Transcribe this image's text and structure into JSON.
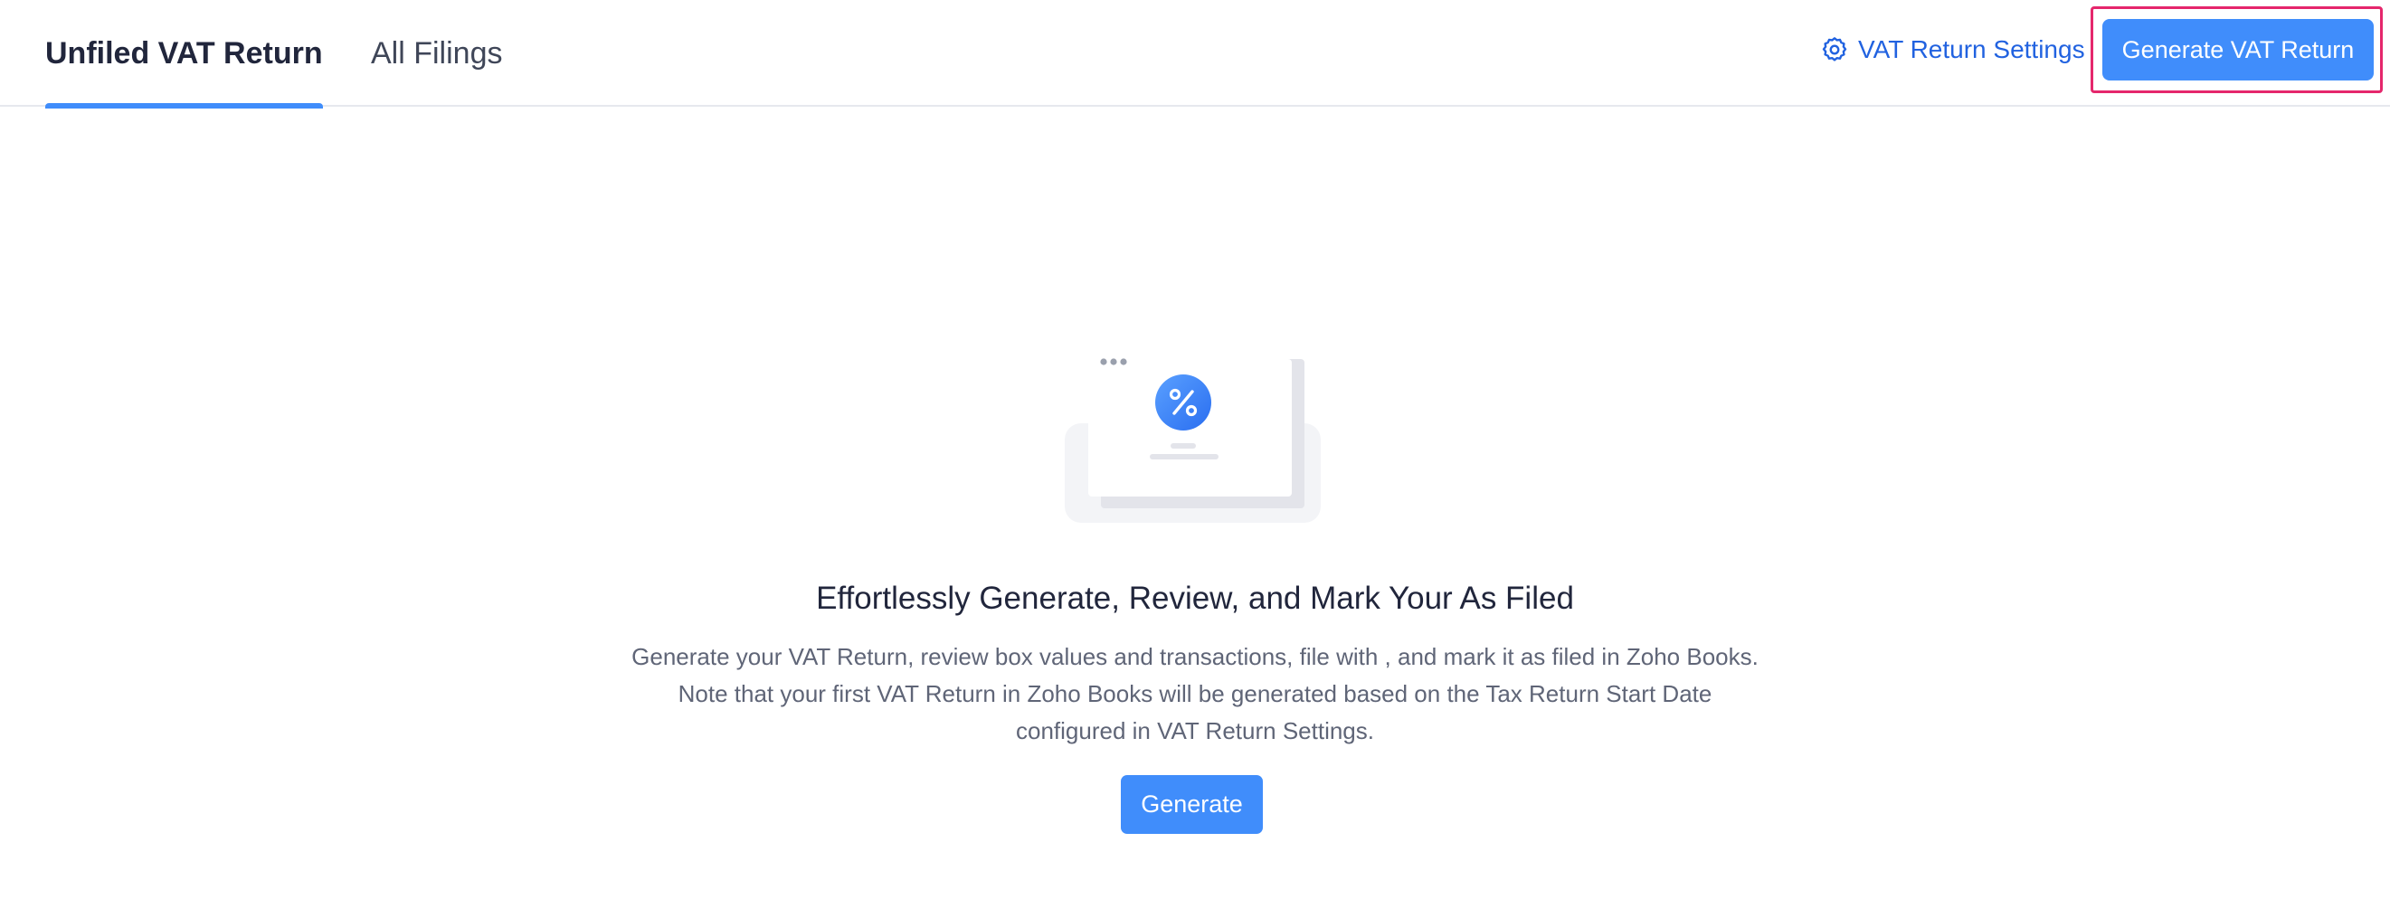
{
  "tabs": [
    {
      "label": "Unfiled VAT Return",
      "active": true
    },
    {
      "label": "All Filings",
      "active": false
    }
  ],
  "header": {
    "settings_label": "VAT Return Settings",
    "settings_icon": "gear-icon",
    "primary_button_label": "Generate VAT Return"
  },
  "empty_state": {
    "illustration_icon": "percent-document-icon",
    "title": "Effortlessly Generate, Review, and Mark Your As Filed",
    "description_lines": [
      "Generate your VAT Return, review box values and transactions, file with , and mark it as filed in Zoho Books.",
      "Note that your first VAT Return in Zoho Books will be generated based on the Tax Return Start Date",
      "configured in VAT Return Settings."
    ],
    "button_label": "Generate"
  },
  "colors": {
    "accent": "#408dfb",
    "link": "#2162e0",
    "highlight_border": "#e5276c",
    "text_primary": "#21263c",
    "text_secondary": "#5f6577"
  }
}
